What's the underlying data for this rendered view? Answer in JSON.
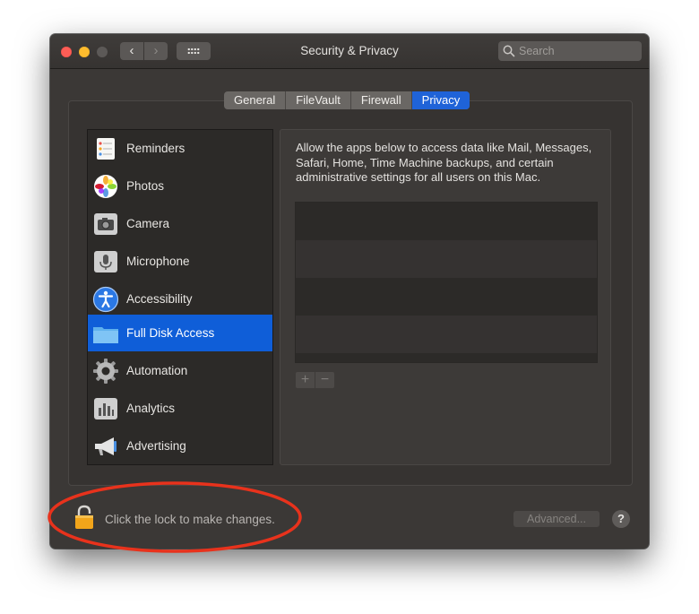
{
  "window": {
    "title": "Security & Privacy",
    "nav_back": "‹",
    "nav_forward": "›",
    "search_placeholder": "Search"
  },
  "tabs": [
    {
      "label": "General",
      "active": false
    },
    {
      "label": "FileVault",
      "active": false
    },
    {
      "label": "Firewall",
      "active": false
    },
    {
      "label": "Privacy",
      "active": true
    }
  ],
  "sidebar": {
    "items": [
      {
        "label": "Reminders",
        "icon": "reminders-icon",
        "selected": false
      },
      {
        "label": "Photos",
        "icon": "photos-icon",
        "selected": false
      },
      {
        "label": "Camera",
        "icon": "camera-icon",
        "selected": false
      },
      {
        "label": "Microphone",
        "icon": "microphone-icon",
        "selected": false
      },
      {
        "label": "Accessibility",
        "icon": "accessibility-icon",
        "selected": false
      },
      {
        "label": "Full Disk Access",
        "icon": "folder-icon",
        "selected": true
      },
      {
        "label": "Automation",
        "icon": "gear-icon",
        "selected": false
      },
      {
        "label": "Analytics",
        "icon": "analytics-icon",
        "selected": false
      },
      {
        "label": "Advertising",
        "icon": "megaphone-icon",
        "selected": false
      }
    ]
  },
  "content": {
    "description": "Allow the apps below to access data like Mail, Messages, Safari, Home, Time Machine backups, and certain administrative settings for all users on this Mac.",
    "add_label": "+",
    "remove_label": "−"
  },
  "footer": {
    "lock_text": "Click the lock to make changes.",
    "advanced_label": "Advanced...",
    "help_label": "?"
  },
  "colors": {
    "accent": "#0f5ed8",
    "annotation": "#e8321c",
    "window_bg": "#3b3836"
  }
}
